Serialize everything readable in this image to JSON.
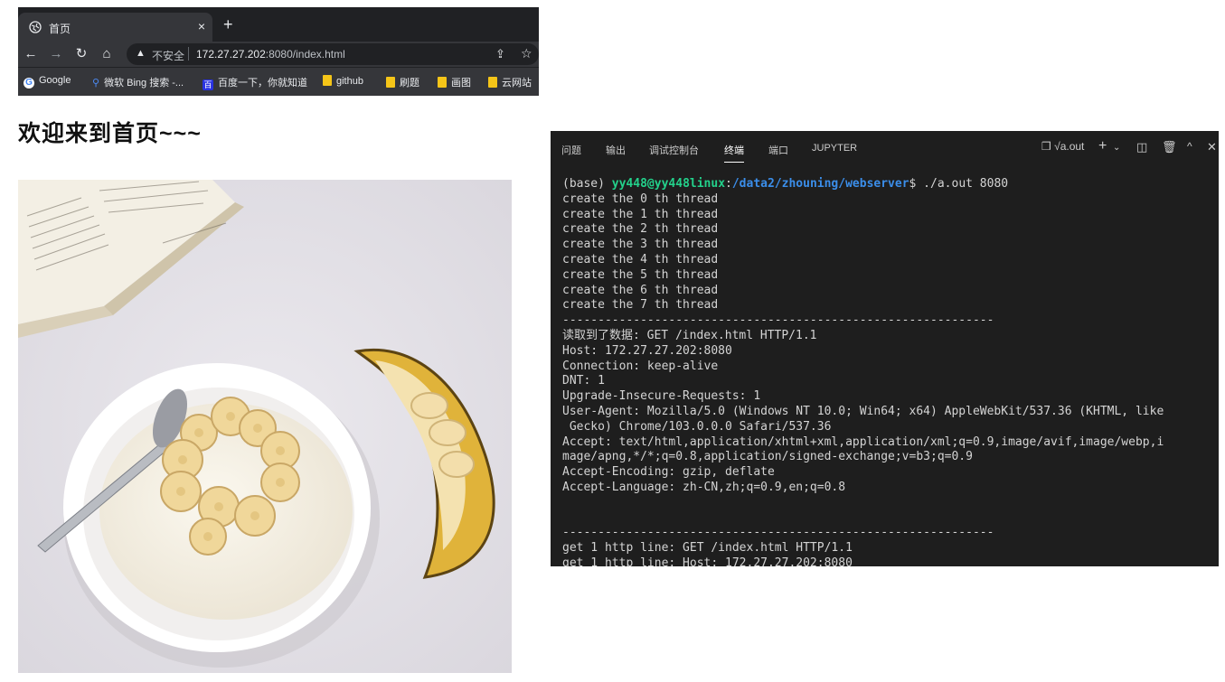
{
  "browser": {
    "tab_title": "首页",
    "tab_close": "×",
    "new_tab": "+",
    "omnibox": {
      "insecure_label": "不安全",
      "url_host": "172.27.27.202",
      "url_rest": ":8080/index.html"
    },
    "bookmarks": [
      {
        "label": "Google",
        "icon": "google-icon"
      },
      {
        "label": "微软 Bing 搜索 -...",
        "icon": "bing-search-icon"
      },
      {
        "label": "百度一下，你就知道",
        "icon": "baidu-icon"
      },
      {
        "label": "github",
        "icon": "folder-icon"
      },
      {
        "label": "刷题",
        "icon": "folder-icon"
      },
      {
        "label": "画图",
        "icon": "folder-icon"
      },
      {
        "label": "云网站",
        "icon": "folder-icon"
      }
    ]
  },
  "page": {
    "heading": "欢迎来到首页~~~"
  },
  "terminal": {
    "tabs": [
      "问题",
      "输出",
      "调试控制台",
      "终端",
      "端口",
      "JUPYTER"
    ],
    "active_tab": "终端",
    "process_label": "√a.out",
    "prompt": {
      "env": "(base) ",
      "user": "yy448@yy448linux",
      "colon": ":",
      "path": "/data2/zhouning/webserver",
      "command": "$ ./a.out 8080"
    },
    "lines": [
      "create the 0 th thread",
      "create the 1 th thread",
      "create the 2 th thread",
      "create the 3 th thread",
      "create the 4 th thread",
      "create the 5 th thread",
      "create the 6 th thread",
      "create the 7 th thread",
      "-------------------------------------------------------------",
      "读取到了数据: GET /index.html HTTP/1.1",
      "Host: 172.27.27.202:8080",
      "Connection: keep-alive",
      "DNT: 1",
      "Upgrade-Insecure-Requests: 1",
      "User-Agent: Mozilla/5.0 (Windows NT 10.0; Win64; x64) AppleWebKit/537.36 (KHTML, like",
      " Gecko) Chrome/103.0.0.0 Safari/537.36",
      "Accept: text/html,application/xhtml+xml,application/xml;q=0.9,image/avif,image/webp,i",
      "mage/apng,*/*;q=0.8,application/signed-exchange;v=b3;q=0.9",
      "Accept-Encoding: gzip, deflate",
      "Accept-Language: zh-CN,zh;q=0.9,en;q=0.8",
      "",
      "",
      "-------------------------------------------------------------",
      "get 1 http line: GET /index.html HTTP/1.1",
      "get 1 http line: Host: 172.27.27.202:8080"
    ]
  }
}
